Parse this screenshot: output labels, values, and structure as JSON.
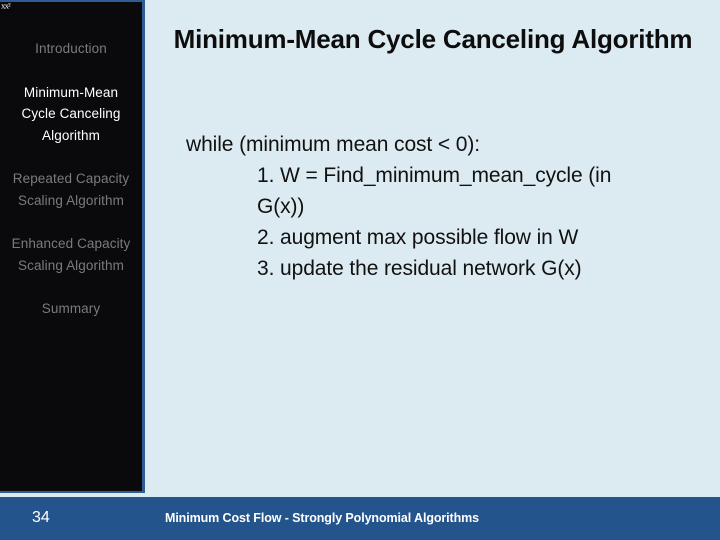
{
  "slide": {
    "background_color": "#dceaf1",
    "artifact_text": "xx²"
  },
  "sidebar": {
    "background_color": "#0a0a0c",
    "border_color": "#2e5d94",
    "active_color": "#ffffff",
    "inactive_color": "#7b7b7b",
    "items": [
      {
        "label": "Introduction",
        "active": false
      },
      {
        "label": "Minimum-Mean Cycle Canceling Algorithm",
        "active": true
      },
      {
        "label": "Repeated Capacity Scaling Algorithm",
        "active": false
      },
      {
        "label": "Enhanced Capacity Scaling Algorithm",
        "active": false
      },
      {
        "label": "Summary",
        "active": false
      }
    ]
  },
  "main": {
    "title": "Minimum-Mean Cycle Canceling Algorithm",
    "body_lines": [
      {
        "text": "while (minimum mean cost < 0):",
        "indent": false
      },
      {
        "text": "1. W = Find_minimum_mean_cycle (in",
        "indent": true
      },
      {
        "text": "G(x))",
        "indent": true
      },
      {
        "text": "2. augment max possible flow in W",
        "indent": true
      },
      {
        "text": "3. update the residual network G(x)",
        "indent": true
      }
    ]
  },
  "footer": {
    "background_color": "#24548c",
    "page_number": "34",
    "title": "Minimum Cost Flow - Strongly Polynomial Algorithms"
  }
}
